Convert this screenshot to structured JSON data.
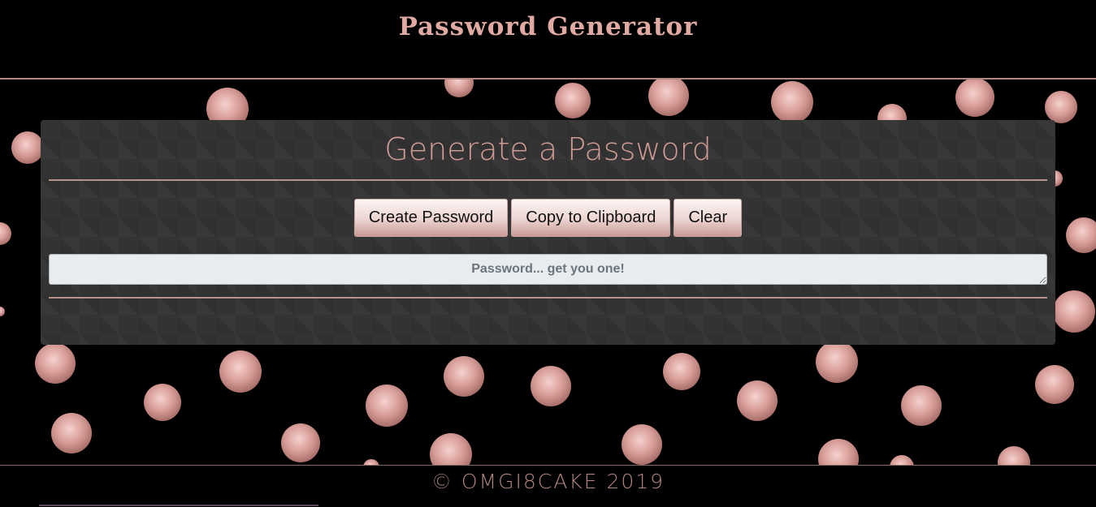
{
  "header": {
    "title": "Password Generator"
  },
  "card": {
    "title": "Generate a Password",
    "buttons": {
      "create_label": "Create Password",
      "copy_label": "Copy to Clipboard",
      "clear_label": "Clear"
    },
    "password_field": {
      "placeholder": "Password... get you one!",
      "value": ""
    }
  },
  "footer": {
    "text": "© OMGI8CAKE 2019"
  },
  "colors": {
    "background": "#000000",
    "accent_pink": "#cf9a93",
    "card_background": "#333333",
    "dot_color": "#e0aaa7"
  }
}
